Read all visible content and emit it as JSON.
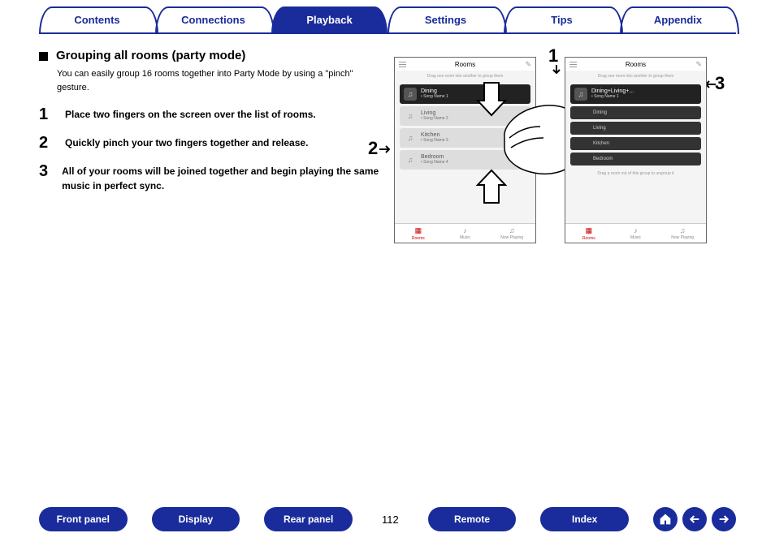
{
  "tabs": {
    "contents": "Contents",
    "connections": "Connections",
    "playback": "Playback",
    "settings": "Settings",
    "tips": "Tips",
    "appendix": "Appendix"
  },
  "section": {
    "title": "Grouping all rooms (party mode)",
    "intro": "You can easily group 16 rooms together into Party Mode by using a \"pinch\" gesture."
  },
  "steps": {
    "s1_num": "1",
    "s1_text": "Place two fingers on the screen over the list of rooms.",
    "s2_num": "2",
    "s2_text": "Quickly pinch your two fingers together and release.",
    "s3_num": "3",
    "s3_text": "All of your rooms will be joined together and begin playing the same music in perfect sync."
  },
  "callouts": {
    "c1": "1",
    "c2": "2",
    "c3": "3"
  },
  "phone_common": {
    "title": "Rooms",
    "edit_glyph": "✎",
    "note_glyph": "♫",
    "hint": "Drag one room into another to group them",
    "ungroup_hint": "Drag a room out of this group to ungroup it",
    "bottom": {
      "rooms": "Rooms",
      "music": "Music",
      "now": "Now Playing"
    }
  },
  "phone1": {
    "r1_name": "Dining",
    "r1_song": "• Song Name 1",
    "r2_name": "Living",
    "r2_song": "• Song Name 2",
    "r3_name": "Kitchen",
    "r3_song": "• Song Name 3",
    "r4_name": "Bedroom",
    "r4_song": "• Song Name 4"
  },
  "phone2": {
    "group_name": "Dining+Living+...",
    "group_song": "• Song Name 1",
    "g1": "Dining",
    "g2": "Living",
    "g3": "Kitchen",
    "g4": "Bedroom"
  },
  "bottom": {
    "front_panel": "Front panel",
    "display": "Display",
    "rear_panel": "Rear panel",
    "remote": "Remote",
    "index": "Index",
    "page": "112"
  }
}
